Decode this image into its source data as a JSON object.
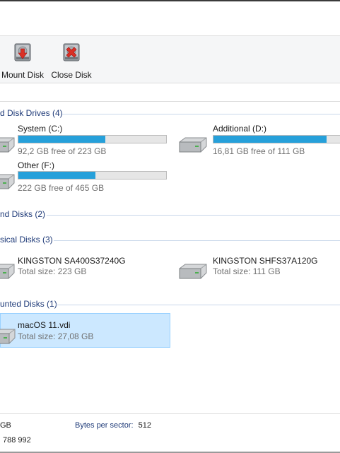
{
  "toolbar": {
    "mount_label": "Mount Disk",
    "close_label": "Close Disk"
  },
  "groups": {
    "hard_disk_drives": "d Disk Drives (4)",
    "removable": "nd Disks (2)",
    "physical": "sical Disks (3)",
    "mounted": "unted Disks (1)"
  },
  "hard_drives": [
    {
      "name": "System (C:)",
      "free": "92,2 GB free of 223 GB",
      "used_fraction": 0.59
    },
    {
      "name": "Additional (D:)",
      "free": "16,81 GB free of 111 GB",
      "used_fraction": 0.85
    },
    {
      "name": "Other (F:)",
      "free": "222 GB free of 465 GB",
      "used_fraction": 0.52
    }
  ],
  "physical_disks": [
    {
      "name": "KINGSTON SA400S37240G",
      "size": "Total size: 223 GB"
    },
    {
      "name": "KINGSTON SHFS37A120G",
      "size": "Total size: 111 GB"
    }
  ],
  "mounted_disks": [
    {
      "name": "macOS 11.vdi",
      "size": "Total size: 27,08 GB"
    }
  ],
  "status": {
    "left_top": "GB",
    "left_bottom": "788 992",
    "bytes_label": "Bytes per sector:",
    "bytes_value": "512"
  },
  "colors": {
    "accent": "#26a0da",
    "group_header": "#1e3a78",
    "selection": "#cce8ff"
  }
}
